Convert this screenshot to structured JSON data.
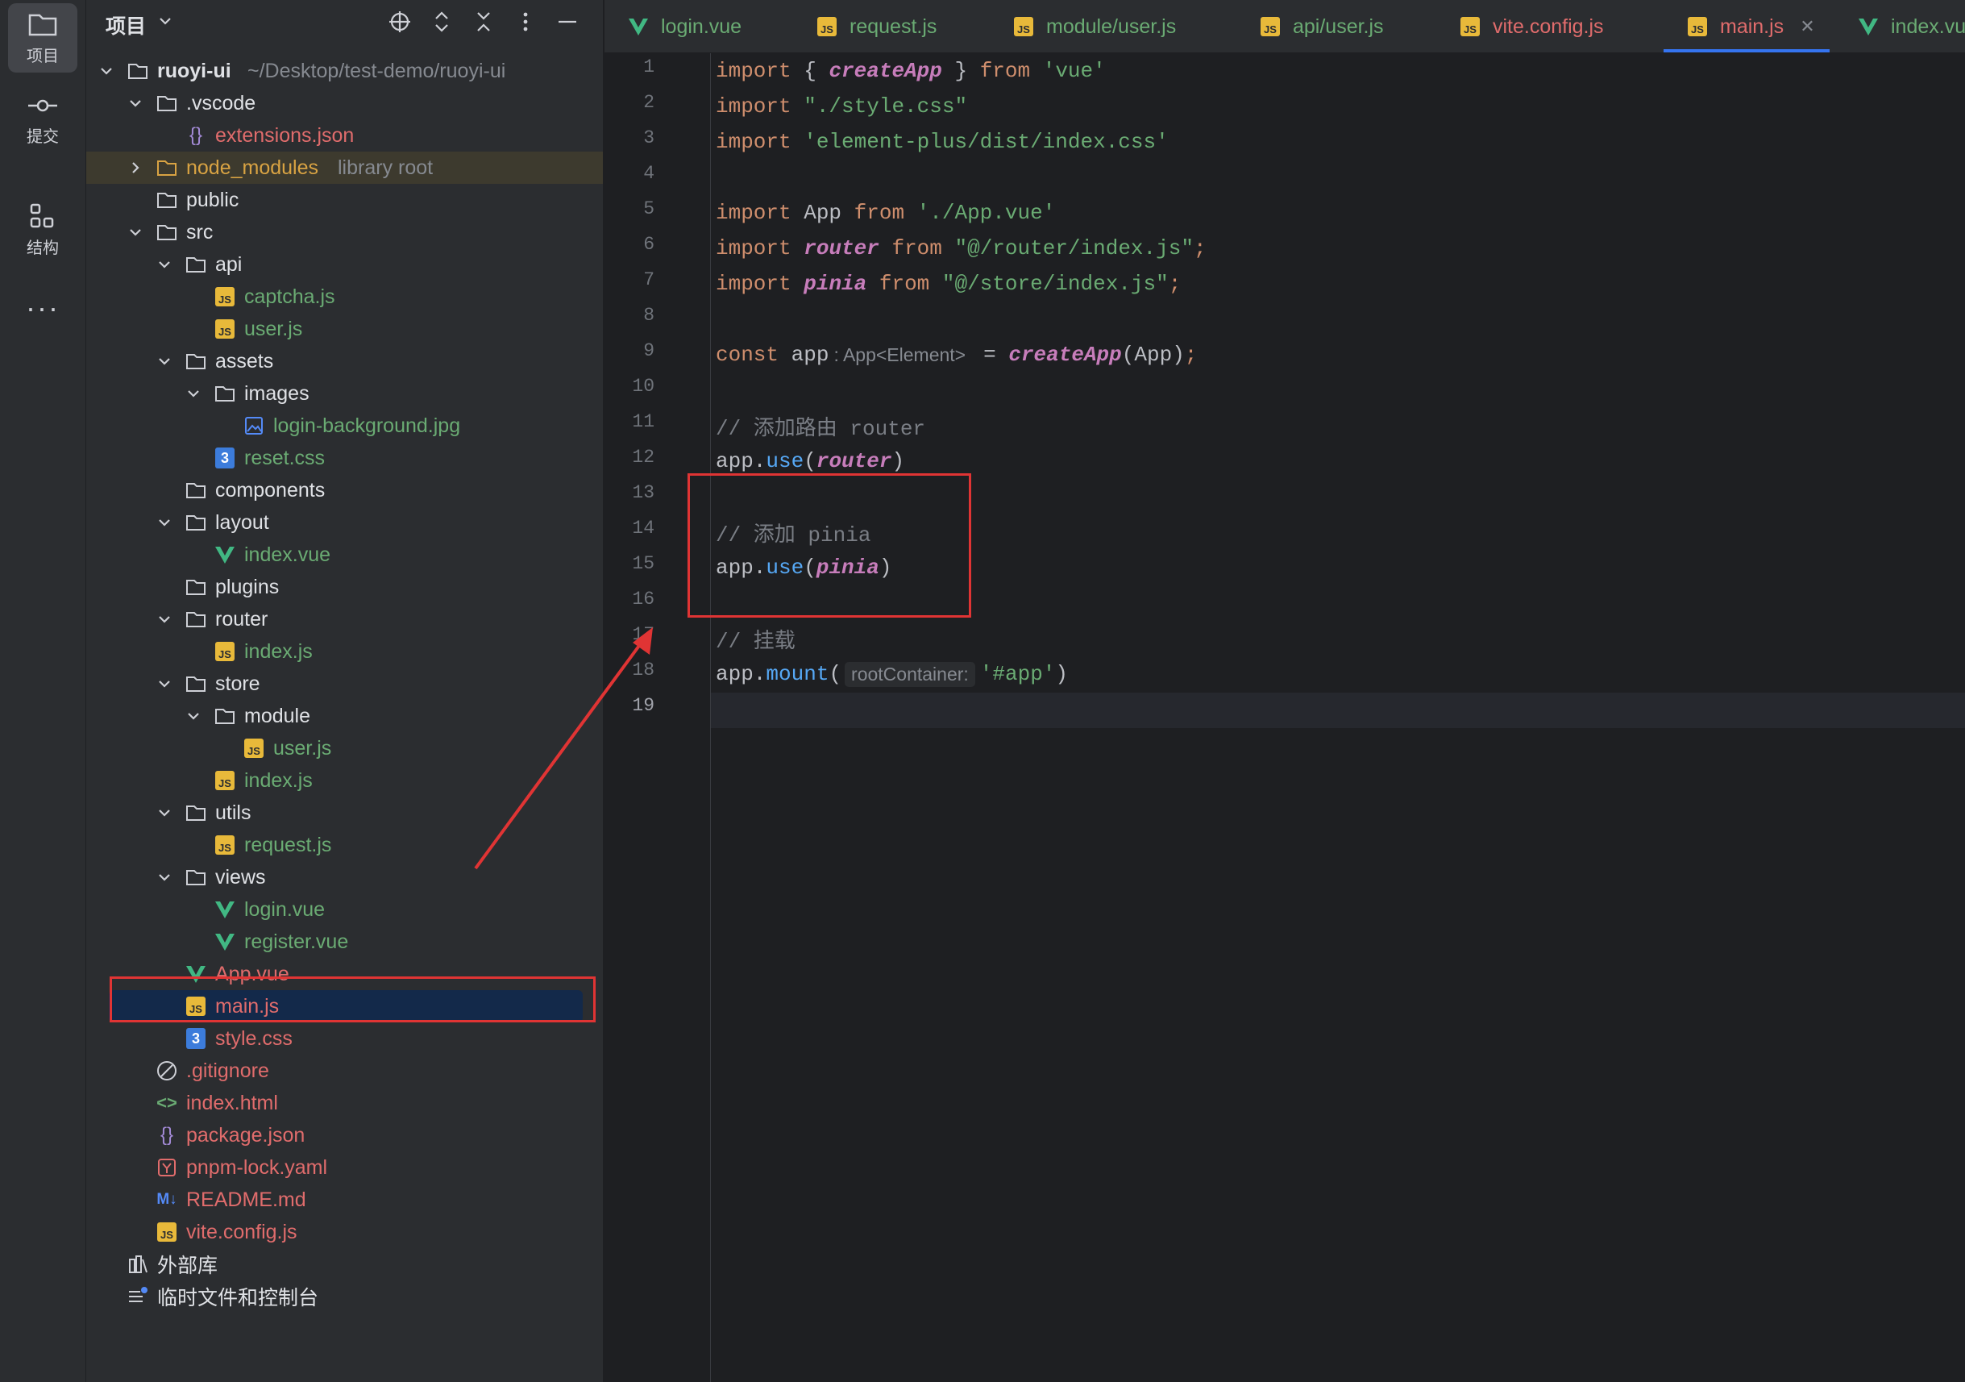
{
  "toolstrip": {
    "project_label": "项目",
    "commit_label": "提交",
    "structure_label": "结构",
    "more_label": "···"
  },
  "panel": {
    "title": "项目"
  },
  "tree": {
    "root_name": "ruoyi-ui",
    "root_path": "~/Desktop/test-demo/ruoyi-ui",
    "vscode": ".vscode",
    "extensions_json": "extensions.json",
    "node_modules": "node_modules",
    "node_modules_hint": "library root",
    "public": "public",
    "src": "src",
    "api": "api",
    "captcha_js": "captcha.js",
    "api_user_js": "user.js",
    "assets": "assets",
    "images": "images",
    "login_bg": "login-background.jpg",
    "reset_css": "reset.css",
    "components": "components",
    "layout": "layout",
    "layout_index_vue": "index.vue",
    "plugins": "plugins",
    "router": "router",
    "router_index_js": "index.js",
    "store": "store",
    "module": "module",
    "module_user_js": "user.js",
    "store_index_js": "index.js",
    "utils": "utils",
    "request_js": "request.js",
    "views": "views",
    "login_vue": "login.vue",
    "register_vue": "register.vue",
    "app_vue": "App.vue",
    "main_js": "main.js",
    "style_css": "style.css",
    "gitignore": ".gitignore",
    "index_html": "index.html",
    "package_json": "package.json",
    "pnpm_lock": "pnpm-lock.yaml",
    "readme": "README.md",
    "readme_badge": "M↓",
    "vite_config": "vite.config.js",
    "external_libs": "外部库",
    "scratches": "临时文件和控制台"
  },
  "tabs": [
    {
      "label": "login.vue",
      "icon": "vue-icon",
      "color": "#6aab73"
    },
    {
      "label": "request.js",
      "icon": "js-icon",
      "color": "#6aab73"
    },
    {
      "label": "module/user.js",
      "icon": "js-icon",
      "color": "#6aab73"
    },
    {
      "label": "api/user.js",
      "icon": "js-icon",
      "color": "#6aab73"
    },
    {
      "label": "vite.config.js",
      "icon": "js-icon",
      "color": "#e06c6c"
    },
    {
      "label": "main.js",
      "icon": "js-icon",
      "color": "#e06c6c",
      "active": true
    },
    {
      "label": "index.vu",
      "icon": "vue-icon",
      "color": "#6aab73"
    }
  ],
  "editor": {
    "line_numbers": [
      "1",
      "2",
      "3",
      "4",
      "5",
      "6",
      "7",
      "8",
      "9",
      "10",
      "11",
      "12",
      "13",
      "14",
      "15",
      "16",
      "17",
      "18",
      "19"
    ],
    "current_line": "19",
    "lines": {
      "l1_kw": "import",
      "l1_a": " { ",
      "l1_fn": "createApp",
      "l1_b": " } ",
      "l1_from": "from",
      "l1_str": " 'vue'",
      "l2_kw": "import",
      "l2_str": " \"./style.css\"",
      "l3_kw": "import",
      "l3_str": " 'element-plus/dist/index.css'",
      "l5_kw": "import",
      "l5_a": " App ",
      "l5_from": "from",
      "l5_str": " './App.vue'",
      "l6_kw": "import",
      "l6_sp": " ",
      "l6_it": "router",
      "l6_sp2": " ",
      "l6_from": "from",
      "l6_str": " \"@/router/index.js\"",
      "l6_semi": ";",
      "l7_kw": "import",
      "l7_sp": " ",
      "l7_it": "pinia",
      "l7_sp2": " ",
      "l7_from": "from",
      "l7_str": " \"@/store/index.js\"",
      "l7_semi": ";",
      "l9_kw": "const",
      "l9_a": " app",
      "l9_hint": ": App<Element>",
      "l9_b": "= ",
      "l9_fn": "createApp",
      "l9_c": "(App)",
      "l9_semi": ";",
      "l11_cm": "// 添加路由 router",
      "l12_a": "app.",
      "l12_m": "use",
      "l12_b": "(",
      "l12_it": "router",
      "l12_c": ")",
      "l14_cm": "// 添加 pinia",
      "l15_a": "app.",
      "l15_m": "use",
      "l15_b": "(",
      "l15_it": "pinia",
      "l15_c": ")",
      "l17_cm": "// 挂载",
      "l18_a": "app.",
      "l18_m": "mount",
      "l18_b": "(",
      "l18_hint": "rootContainer:",
      "l18_str": "'#app'",
      "l18_c": ")"
    }
  },
  "colors": {
    "annotation": "#e03434",
    "selection": "#13294a",
    "accent": "#3574f0"
  }
}
